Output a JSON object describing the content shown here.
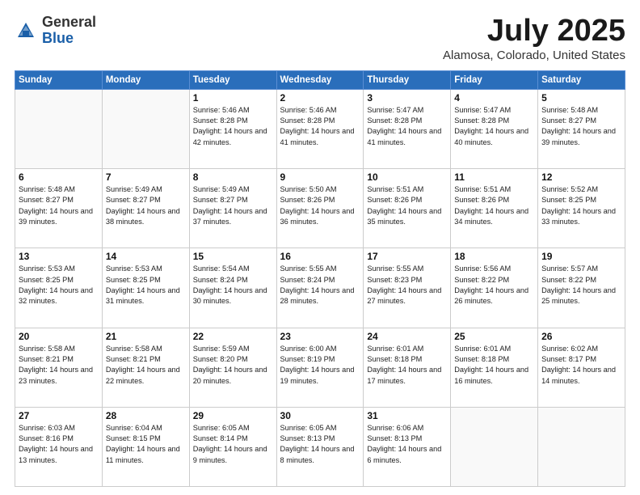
{
  "logo": {
    "general": "General",
    "blue": "Blue"
  },
  "title": "July 2025",
  "subtitle": "Alamosa, Colorado, United States",
  "days": [
    "Sunday",
    "Monday",
    "Tuesday",
    "Wednesday",
    "Thursday",
    "Friday",
    "Saturday"
  ],
  "weeks": [
    [
      {
        "day": "",
        "sunrise": "",
        "sunset": "",
        "daylight": ""
      },
      {
        "day": "",
        "sunrise": "",
        "sunset": "",
        "daylight": ""
      },
      {
        "day": "1",
        "sunrise": "Sunrise: 5:46 AM",
        "sunset": "Sunset: 8:28 PM",
        "daylight": "Daylight: 14 hours and 42 minutes."
      },
      {
        "day": "2",
        "sunrise": "Sunrise: 5:46 AM",
        "sunset": "Sunset: 8:28 PM",
        "daylight": "Daylight: 14 hours and 41 minutes."
      },
      {
        "day": "3",
        "sunrise": "Sunrise: 5:47 AM",
        "sunset": "Sunset: 8:28 PM",
        "daylight": "Daylight: 14 hours and 41 minutes."
      },
      {
        "day": "4",
        "sunrise": "Sunrise: 5:47 AM",
        "sunset": "Sunset: 8:28 PM",
        "daylight": "Daylight: 14 hours and 40 minutes."
      },
      {
        "day": "5",
        "sunrise": "Sunrise: 5:48 AM",
        "sunset": "Sunset: 8:27 PM",
        "daylight": "Daylight: 14 hours and 39 minutes."
      }
    ],
    [
      {
        "day": "6",
        "sunrise": "Sunrise: 5:48 AM",
        "sunset": "Sunset: 8:27 PM",
        "daylight": "Daylight: 14 hours and 39 minutes."
      },
      {
        "day": "7",
        "sunrise": "Sunrise: 5:49 AM",
        "sunset": "Sunset: 8:27 PM",
        "daylight": "Daylight: 14 hours and 38 minutes."
      },
      {
        "day": "8",
        "sunrise": "Sunrise: 5:49 AM",
        "sunset": "Sunset: 8:27 PM",
        "daylight": "Daylight: 14 hours and 37 minutes."
      },
      {
        "day": "9",
        "sunrise": "Sunrise: 5:50 AM",
        "sunset": "Sunset: 8:26 PM",
        "daylight": "Daylight: 14 hours and 36 minutes."
      },
      {
        "day": "10",
        "sunrise": "Sunrise: 5:51 AM",
        "sunset": "Sunset: 8:26 PM",
        "daylight": "Daylight: 14 hours and 35 minutes."
      },
      {
        "day": "11",
        "sunrise": "Sunrise: 5:51 AM",
        "sunset": "Sunset: 8:26 PM",
        "daylight": "Daylight: 14 hours and 34 minutes."
      },
      {
        "day": "12",
        "sunrise": "Sunrise: 5:52 AM",
        "sunset": "Sunset: 8:25 PM",
        "daylight": "Daylight: 14 hours and 33 minutes."
      }
    ],
    [
      {
        "day": "13",
        "sunrise": "Sunrise: 5:53 AM",
        "sunset": "Sunset: 8:25 PM",
        "daylight": "Daylight: 14 hours and 32 minutes."
      },
      {
        "day": "14",
        "sunrise": "Sunrise: 5:53 AM",
        "sunset": "Sunset: 8:25 PM",
        "daylight": "Daylight: 14 hours and 31 minutes."
      },
      {
        "day": "15",
        "sunrise": "Sunrise: 5:54 AM",
        "sunset": "Sunset: 8:24 PM",
        "daylight": "Daylight: 14 hours and 30 minutes."
      },
      {
        "day": "16",
        "sunrise": "Sunrise: 5:55 AM",
        "sunset": "Sunset: 8:24 PM",
        "daylight": "Daylight: 14 hours and 28 minutes."
      },
      {
        "day": "17",
        "sunrise": "Sunrise: 5:55 AM",
        "sunset": "Sunset: 8:23 PM",
        "daylight": "Daylight: 14 hours and 27 minutes."
      },
      {
        "day": "18",
        "sunrise": "Sunrise: 5:56 AM",
        "sunset": "Sunset: 8:22 PM",
        "daylight": "Daylight: 14 hours and 26 minutes."
      },
      {
        "day": "19",
        "sunrise": "Sunrise: 5:57 AM",
        "sunset": "Sunset: 8:22 PM",
        "daylight": "Daylight: 14 hours and 25 minutes."
      }
    ],
    [
      {
        "day": "20",
        "sunrise": "Sunrise: 5:58 AM",
        "sunset": "Sunset: 8:21 PM",
        "daylight": "Daylight: 14 hours and 23 minutes."
      },
      {
        "day": "21",
        "sunrise": "Sunrise: 5:58 AM",
        "sunset": "Sunset: 8:21 PM",
        "daylight": "Daylight: 14 hours and 22 minutes."
      },
      {
        "day": "22",
        "sunrise": "Sunrise: 5:59 AM",
        "sunset": "Sunset: 8:20 PM",
        "daylight": "Daylight: 14 hours and 20 minutes."
      },
      {
        "day": "23",
        "sunrise": "Sunrise: 6:00 AM",
        "sunset": "Sunset: 8:19 PM",
        "daylight": "Daylight: 14 hours and 19 minutes."
      },
      {
        "day": "24",
        "sunrise": "Sunrise: 6:01 AM",
        "sunset": "Sunset: 8:18 PM",
        "daylight": "Daylight: 14 hours and 17 minutes."
      },
      {
        "day": "25",
        "sunrise": "Sunrise: 6:01 AM",
        "sunset": "Sunset: 8:18 PM",
        "daylight": "Daylight: 14 hours and 16 minutes."
      },
      {
        "day": "26",
        "sunrise": "Sunrise: 6:02 AM",
        "sunset": "Sunset: 8:17 PM",
        "daylight": "Daylight: 14 hours and 14 minutes."
      }
    ],
    [
      {
        "day": "27",
        "sunrise": "Sunrise: 6:03 AM",
        "sunset": "Sunset: 8:16 PM",
        "daylight": "Daylight: 14 hours and 13 minutes."
      },
      {
        "day": "28",
        "sunrise": "Sunrise: 6:04 AM",
        "sunset": "Sunset: 8:15 PM",
        "daylight": "Daylight: 14 hours and 11 minutes."
      },
      {
        "day": "29",
        "sunrise": "Sunrise: 6:05 AM",
        "sunset": "Sunset: 8:14 PM",
        "daylight": "Daylight: 14 hours and 9 minutes."
      },
      {
        "day": "30",
        "sunrise": "Sunrise: 6:05 AM",
        "sunset": "Sunset: 8:13 PM",
        "daylight": "Daylight: 14 hours and 8 minutes."
      },
      {
        "day": "31",
        "sunrise": "Sunrise: 6:06 AM",
        "sunset": "Sunset: 8:13 PM",
        "daylight": "Daylight: 14 hours and 6 minutes."
      },
      {
        "day": "",
        "sunrise": "",
        "sunset": "",
        "daylight": ""
      },
      {
        "day": "",
        "sunrise": "",
        "sunset": "",
        "daylight": ""
      }
    ]
  ]
}
